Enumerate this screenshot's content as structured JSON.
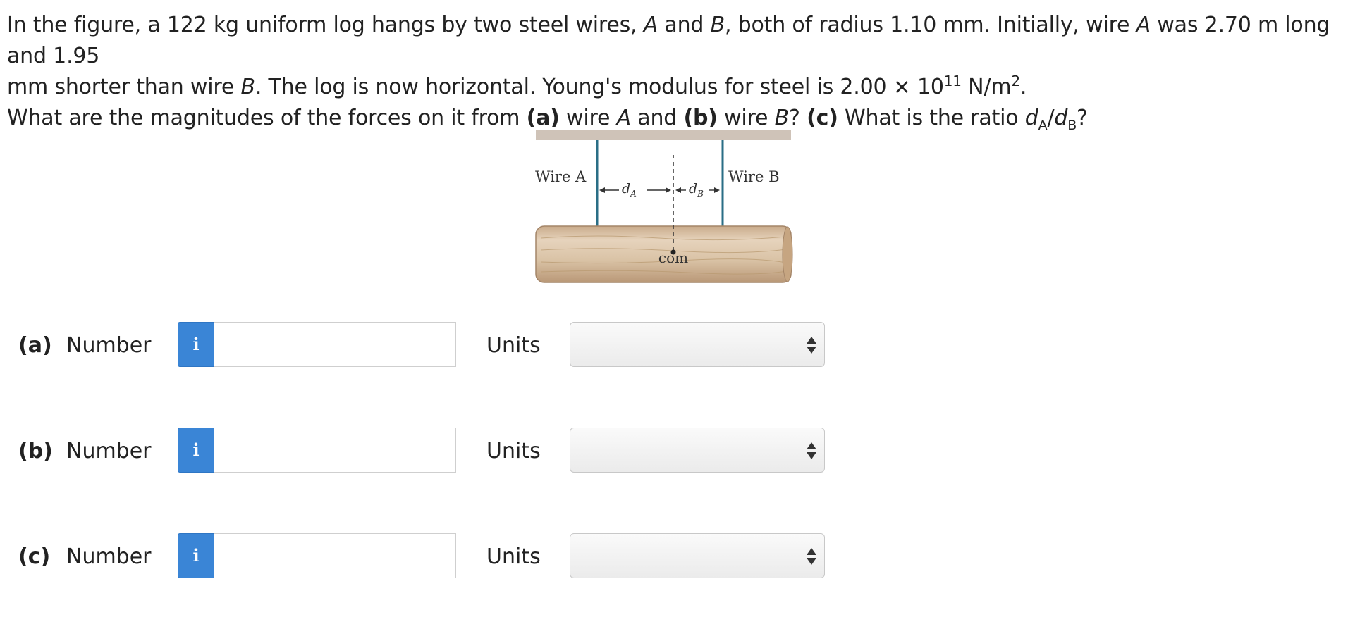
{
  "question": {
    "line1_pre": "In the figure, a 122 kg uniform log hangs by two steel wires, ",
    "A1": "A",
    "line1_and": " and ",
    "B1": "B",
    "line1_mid": ", both of radius 1.10 mm. Initially, wire ",
    "A2": "A",
    "line1_end": " was 2.70 m long and 1.95",
    "line2_pre": "mm shorter than wire ",
    "B2": "B",
    "line2_mid": ". The log is now horizontal. Young's modulus for steel is 2.00 × 10",
    "exp": "11",
    "line2_unit": " N/m",
    "sq": "2",
    "line2_end": ".",
    "line3_pre": "What are the magnitudes of the forces on it from ",
    "a_label": "(a)",
    "line3_wireA": " wire ",
    "A3": "A",
    "line3_and": " and ",
    "b_label": "(b)",
    "line3_wireB": " wire ",
    "B3": "B",
    "line3_q": "? ",
    "c_label": "(c)",
    "line3_ratio": " What is the ratio ",
    "d1": "d",
    "sub1": "A",
    "slash": "/",
    "d2": "d",
    "sub2": "B",
    "line3_end": "?"
  },
  "figure": {
    "wire_a_label": "Wire A",
    "wire_b_label": "Wire B",
    "da_label": "d",
    "da_sub": "A",
    "db_label": "d",
    "db_sub": "B",
    "com_label": "com",
    "colors": {
      "ceiling": "#cfc3b8",
      "wire": "#2a6e86",
      "log": "#d8bfa0",
      "log_edge": "#a48568"
    }
  },
  "answers": [
    {
      "part": "(a)",
      "number_label": "Number",
      "info_icon": "i",
      "value": "",
      "units_label": "Units",
      "units_value": ""
    },
    {
      "part": "(b)",
      "number_label": "Number",
      "info_icon": "i",
      "value": "",
      "units_label": "Units",
      "units_value": ""
    },
    {
      "part": "(c)",
      "number_label": "Number",
      "info_icon": "i",
      "value": "",
      "units_label": "Units",
      "units_value": ""
    }
  ],
  "colors": {
    "info_button": "#3a85d6",
    "text": "#222222"
  }
}
